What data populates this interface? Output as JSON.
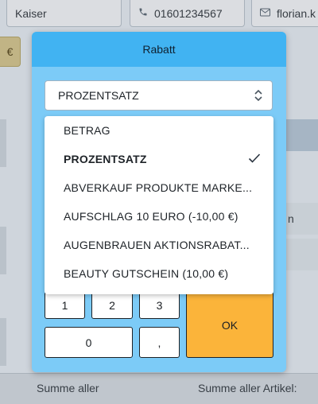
{
  "background": {
    "customer_name": "Kaiser",
    "phone": "01601234567",
    "email": "florian.k",
    "amount_badge": "€",
    "right_text_1": "n",
    "bottom_left_label": "Summe aller",
    "bottom_right_label": "Summe aller Artikel:"
  },
  "modal": {
    "title": "Rabatt",
    "selected_value": "PROZENTSATZ",
    "dropdown_items": [
      {
        "label": "BETRAG",
        "selected": false
      },
      {
        "label": "PROZENTSATZ",
        "selected": true
      },
      {
        "label": "ABVERKAUF PRODUKTE MARKE...",
        "selected": false
      },
      {
        "label": "AUFSCHLAG 10 EURO (-10,00 €)",
        "selected": false
      },
      {
        "label": "AUGENBRAUEN AKTIONSRABAT...",
        "selected": false
      },
      {
        "label": "BEAUTY GUTSCHEIN (10,00 €)",
        "selected": false
      }
    ],
    "keypad": {
      "k1": "1",
      "k2": "2",
      "k3": "3",
      "k0": "0",
      "comma": ",",
      "ok": "OK"
    }
  },
  "colors": {
    "modal_header": "#41b3f2",
    "modal_body": "#7ccbf7",
    "ok_button": "#fbb43a"
  }
}
